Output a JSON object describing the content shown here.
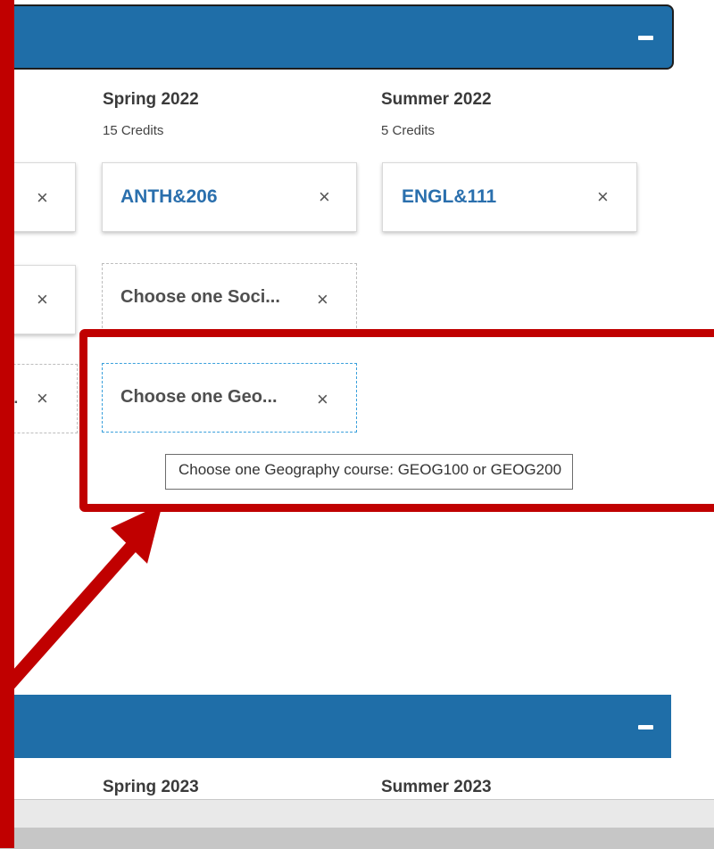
{
  "sections": [
    {
      "terms": [
        {
          "title": "Spring 2022",
          "credits": "15 Credits"
        },
        {
          "title": "Summer 2022",
          "credits": "5 Credits"
        }
      ]
    },
    {
      "terms": [
        {
          "title": "Spring 2023"
        },
        {
          "title": "Summer 2023"
        }
      ]
    }
  ],
  "cards": {
    "spring2022_course": "ANTH&206",
    "summer2022_course": "ENGL&111",
    "social_science_placeholder": "Choose one Soci...",
    "geography_placeholder": "Choose one Geo...",
    "partial_left_placeholder": "...",
    "remove_symbol": "×"
  },
  "tooltip": {
    "text": "Choose one Geography course: GEOG100 or GEOG200"
  },
  "colors": {
    "section_bar": "#1f6ea8",
    "course_code": "#2a6fad",
    "annotation_red": "#c00000",
    "active_dashed_border": "#3aa0dc"
  }
}
